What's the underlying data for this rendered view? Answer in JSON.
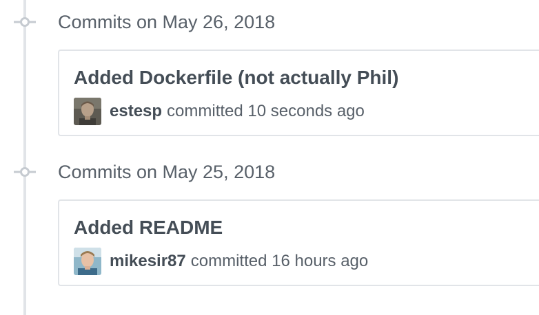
{
  "timeline": {
    "groups": [
      {
        "date_label": "Commits on May 26, 2018",
        "commits": [
          {
            "title": "Added Dockerfile (not actually Phil)",
            "author": "estesp",
            "committed_text": "committed 10 seconds ago",
            "avatar_icon": "user-avatar-estesp"
          }
        ]
      },
      {
        "date_label": "Commits on May 25, 2018",
        "commits": [
          {
            "title": "Added README",
            "author": "mikesir87",
            "committed_text": "committed 16 hours ago",
            "avatar_icon": "user-avatar-mikesir87"
          }
        ]
      }
    ],
    "icons": {
      "commit_node": "git-commit-icon"
    },
    "colors": {
      "timeline_line": "#e1e4e8",
      "commit_node": "#c6cbd1",
      "group_title": "#586069",
      "commit_title": "#444d56",
      "border": "#e1e4e8"
    }
  }
}
